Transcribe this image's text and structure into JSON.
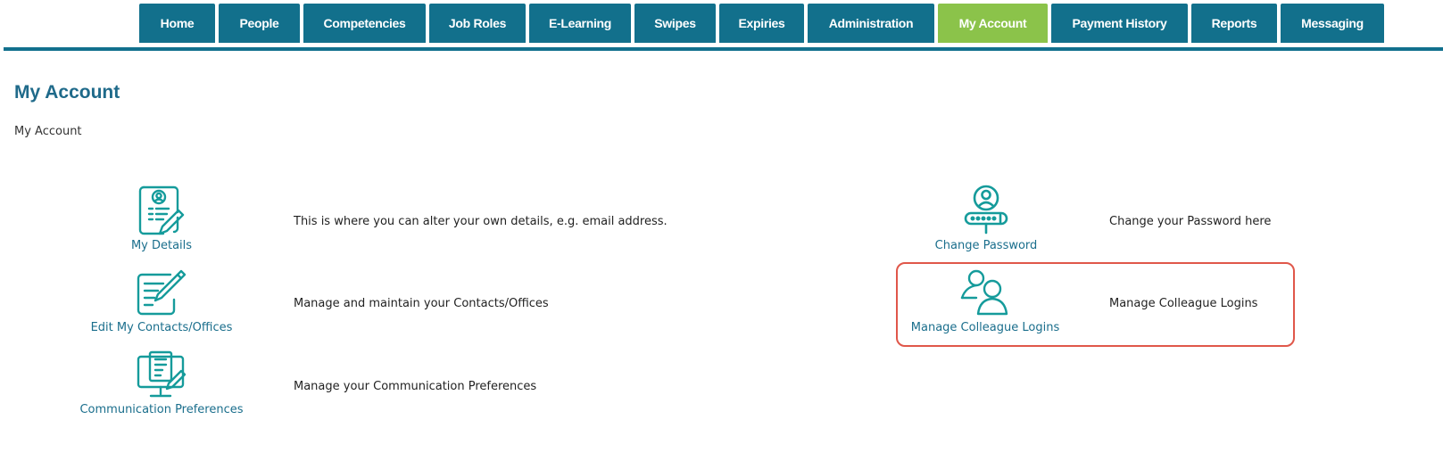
{
  "nav": {
    "tabs": [
      {
        "label": "Home",
        "active": false
      },
      {
        "label": "People",
        "active": false
      },
      {
        "label": "Competencies",
        "active": false
      },
      {
        "label": "Job Roles",
        "active": false
      },
      {
        "label": "E-Learning",
        "active": false
      },
      {
        "label": "Swipes",
        "active": false
      },
      {
        "label": "Expiries",
        "active": false
      },
      {
        "label": "Administration",
        "active": false
      },
      {
        "label": "My Account",
        "active": true
      },
      {
        "label": "Payment History",
        "active": false
      },
      {
        "label": "Reports",
        "active": false
      },
      {
        "label": "Messaging",
        "active": false
      }
    ],
    "colors": {
      "tab": "#12708c",
      "active": "#8bc34a",
      "rule": "#11708d"
    }
  },
  "page": {
    "title": "My Account",
    "breadcrumb": "My Account"
  },
  "items": {
    "my_details": {
      "label": "My Details",
      "description": "This is where you can alter your own details, e.g. email address.",
      "icon": "profile-document-icon"
    },
    "edit_contacts": {
      "label": "Edit My Contacts/Offices",
      "description": "Manage and maintain your Contacts/Offices",
      "icon": "edit-document-icon"
    },
    "comm_prefs": {
      "label": "Communication Preferences",
      "description": "Manage your Communication Preferences",
      "icon": "monitor-document-icon"
    },
    "change_password": {
      "label": "Change Password",
      "description": "Change your Password here",
      "icon": "user-password-icon"
    },
    "colleague_logins": {
      "label": "Manage Colleague Logins",
      "description": "Manage Colleague Logins",
      "icon": "users-icon",
      "highlighted": true
    }
  },
  "colors": {
    "accent": "#1a6e8c",
    "icon": "#159b9b",
    "highlight": "#e0574a"
  }
}
